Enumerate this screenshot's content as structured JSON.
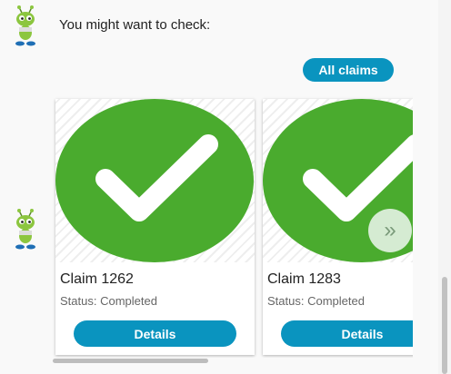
{
  "chat": {
    "message": "You might want to check:",
    "all_claims_label": "All claims"
  },
  "cards": [
    {
      "title": "Claim 1262",
      "status": "Status: Completed",
      "button": "Details"
    },
    {
      "title": "Claim 1283",
      "status": "Status: Completed",
      "button": "Details"
    }
  ],
  "carousel": {
    "next_label": "»"
  },
  "colors": {
    "accent": "#0a94bf",
    "check_green": "#4aab2e"
  },
  "icons": [
    "bot-avatar-icon",
    "checkmark-icon",
    "chevron-double-right-icon"
  ]
}
